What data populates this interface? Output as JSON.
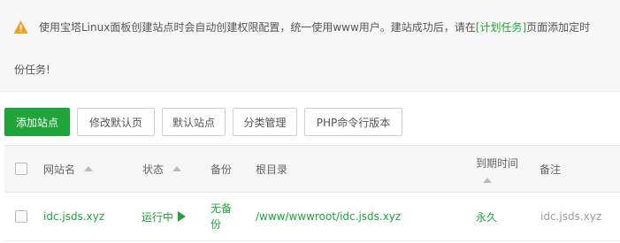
{
  "notice": {
    "icon": "warning-icon",
    "text_before_link": "使用宝塔Linux面板创建站点时会自动创建权限配置，统一使用www用户。建站成功后，请在",
    "link_text": "[计划任务]",
    "text_after_link": "页面添加定时",
    "line2": "份任务!"
  },
  "toolbar": {
    "add_site": "添加站点",
    "edit_default_page": "修改默认页",
    "default_site": "默认站点",
    "category_manage": "分类管理",
    "php_cli_version": "PHP命令行版本"
  },
  "table": {
    "headers": {
      "site_name": "网站名",
      "status": "状态",
      "backup": "备份",
      "root_dir": "根目录",
      "expire_time": "到期时间",
      "remark": "备注"
    },
    "rows": [
      {
        "site_name": "idc.jsds.xyz",
        "status": "运行中",
        "backup": "无备份",
        "root_dir": "/www/wwwroot/idc.jsds.xyz",
        "expire_time": "永久",
        "remark": "idc.jsds.xyz"
      }
    ]
  },
  "colors": {
    "accent": "#20a53a",
    "warning": "#f0a020"
  }
}
